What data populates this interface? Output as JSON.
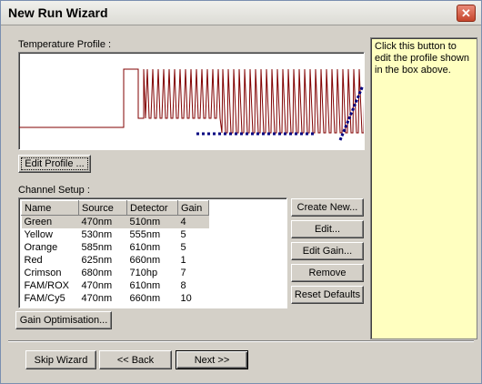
{
  "window": {
    "title": "New Run Wizard",
    "close_glyph": "✕"
  },
  "temperature_profile": {
    "label": "Temperature Profile :",
    "edit_button": "Edit Profile ..."
  },
  "help": {
    "text": "Click this button to edit the profile shown in the box above."
  },
  "channel_setup": {
    "label": "Channel Setup :",
    "columns": [
      "Name",
      "Source",
      "Detector",
      "Gain"
    ],
    "rows": [
      {
        "name": "Green",
        "source": "470nm",
        "detector": "510nm",
        "gain": "4"
      },
      {
        "name": "Yellow",
        "source": "530nm",
        "detector": "555nm",
        "gain": "5"
      },
      {
        "name": "Orange",
        "source": "585nm",
        "detector": "610nm",
        "gain": "5"
      },
      {
        "name": "Red",
        "source": "625nm",
        "detector": "660nm",
        "gain": "1"
      },
      {
        "name": "Crimson",
        "source": "680nm",
        "detector": "710hp",
        "gain": "7"
      },
      {
        "name": "FAM/ROX",
        "source": "470nm",
        "detector": "610nm",
        "gain": "8"
      },
      {
        "name": "FAM/Cy5",
        "source": "470nm",
        "detector": "660nm",
        "gain": "10"
      }
    ],
    "selected_row": 0
  },
  "side_buttons": {
    "create_new": "Create New...",
    "edit": "Edit...",
    "edit_gain": "Edit Gain...",
    "remove": "Remove",
    "reset_defaults": "Reset Defaults"
  },
  "gain_optimisation_button": "Gain Optimisation...",
  "footer": {
    "skip_wizard": "Skip Wizard",
    "back": "<< Back",
    "next": "Next >>"
  },
  "colors": {
    "profile_line": "#800000",
    "acquisition_marker": "#000080"
  }
}
